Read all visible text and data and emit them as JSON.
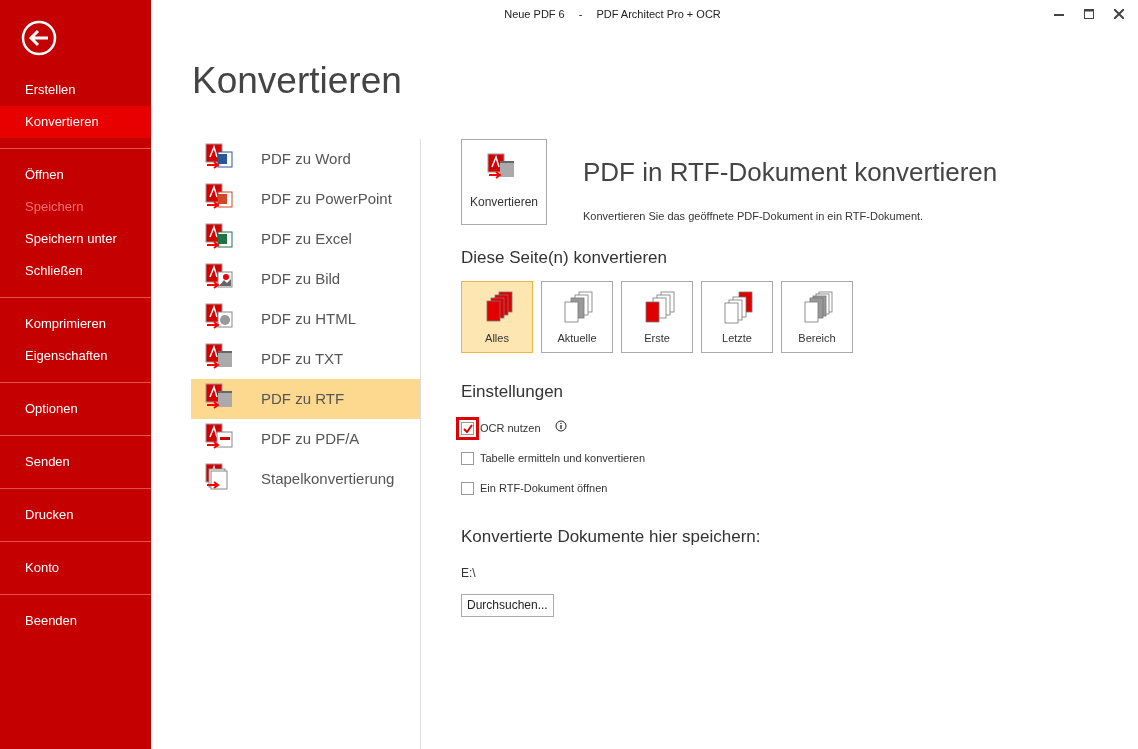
{
  "window": {
    "title_document": "Neue PDF 6",
    "title_separator": "-",
    "title_app": "PDF Architect Pro + OCR"
  },
  "sidebar": {
    "groups": [
      [
        {
          "label": "Erstellen",
          "selected": false,
          "disabled": false
        },
        {
          "label": "Konvertieren",
          "selected": true,
          "disabled": false
        }
      ],
      [
        {
          "label": "Öffnen",
          "selected": false,
          "disabled": false
        },
        {
          "label": "Speichern",
          "selected": false,
          "disabled": true
        },
        {
          "label": "Speichern unter",
          "selected": false,
          "disabled": false
        },
        {
          "label": "Schließen",
          "selected": false,
          "disabled": false
        }
      ],
      [
        {
          "label": "Komprimieren",
          "selected": false,
          "disabled": false
        },
        {
          "label": "Eigenschaften",
          "selected": false,
          "disabled": false
        }
      ],
      [
        {
          "label": "Optionen",
          "selected": false,
          "disabled": false
        }
      ],
      [
        {
          "label": "Senden",
          "selected": false,
          "disabled": false
        }
      ],
      [
        {
          "label": "Drucken",
          "selected": false,
          "disabled": false
        }
      ],
      [
        {
          "label": "Konto",
          "selected": false,
          "disabled": false
        }
      ],
      [
        {
          "label": "Beenden",
          "selected": false,
          "disabled": false
        }
      ]
    ]
  },
  "page_title": "Konvertieren",
  "conversions": [
    {
      "label": "PDF zu Word",
      "kind": "word",
      "selected": false
    },
    {
      "label": "PDF zu PowerPoint",
      "kind": "powerpoint",
      "selected": false
    },
    {
      "label": "PDF zu Excel",
      "kind": "excel",
      "selected": false
    },
    {
      "label": "PDF zu Bild",
      "kind": "image",
      "selected": false
    },
    {
      "label": "PDF zu HTML",
      "kind": "html",
      "selected": false
    },
    {
      "label": "PDF zu TXT",
      "kind": "txt",
      "selected": false
    },
    {
      "label": "PDF zu RTF",
      "kind": "rtf",
      "selected": true
    },
    {
      "label": "PDF zu PDF/A",
      "kind": "pdfa",
      "selected": false
    },
    {
      "label": "Stapelkonvertierung",
      "kind": "batch",
      "selected": false
    }
  ],
  "detail": {
    "convert_button": "Konvertieren",
    "heading": "PDF in RTF-Dokument konvertieren",
    "description": "Konvertieren Sie das geöffnete PDF-Dokument in ein RTF-Dokument."
  },
  "pages_section": {
    "heading": "Diese Seite(n) konvertieren",
    "options": [
      {
        "label": "Alles",
        "kind": "all",
        "selected": true
      },
      {
        "label": "Aktuelle",
        "kind": "current",
        "selected": false
      },
      {
        "label": "Erste",
        "kind": "first",
        "selected": false
      },
      {
        "label": "Letzte",
        "kind": "last",
        "selected": false
      },
      {
        "label": "Bereich",
        "kind": "range",
        "selected": false
      }
    ]
  },
  "settings": {
    "heading": "Einstellungen",
    "options": [
      {
        "label": "OCR nutzen",
        "checked": true,
        "highlighted": true,
        "info": true
      },
      {
        "label": "Tabelle ermitteln und konvertieren",
        "checked": false,
        "highlighted": false,
        "info": false
      },
      {
        "label": "Ein RTF-Dokument öffnen",
        "checked": false,
        "highlighted": false,
        "info": false
      }
    ]
  },
  "save_section": {
    "heading": "Konvertierte Dokumente hier speichern:",
    "path": "E:\\",
    "browse_button": "Durchsuchen..."
  }
}
